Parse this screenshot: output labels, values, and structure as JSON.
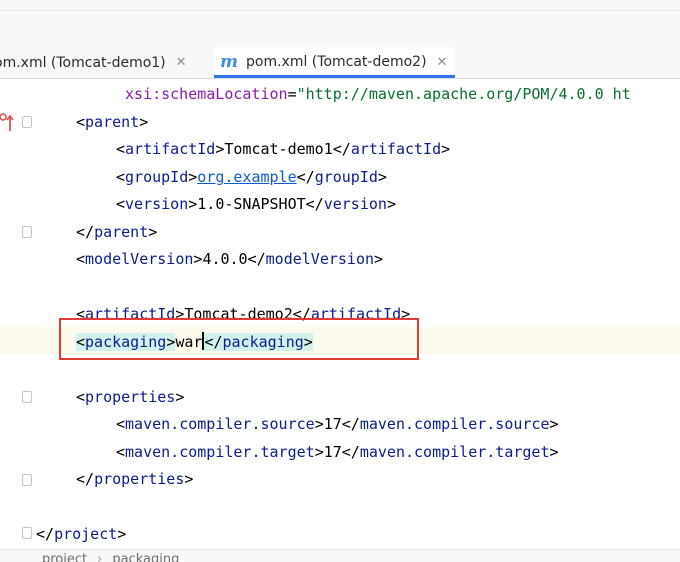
{
  "tabs": [
    {
      "label": "om.xml (Tomcat-demo1)",
      "close": "✕"
    },
    {
      "label": "pom.xml (Tomcat-demo2)",
      "icon": "m",
      "close": "✕"
    }
  ],
  "editor": {
    "lines": [
      {
        "indent": 1,
        "attr": "xsi:schemaLocation",
        "eq": "=",
        "value": "\"http://maven.apache.org/POM/4.0.0 ht"
      },
      {
        "indent": 1,
        "open": "parent"
      },
      {
        "indent": 2,
        "open": "artifactId",
        "text": "Tomcat-demo1",
        "close": "artifactId"
      },
      {
        "indent": 2,
        "open": "groupId",
        "text": "org.example",
        "close": "groupId"
      },
      {
        "indent": 2,
        "open": "version",
        "text": "1.0-SNAPSHOT",
        "close": "version"
      },
      {
        "indent": 1,
        "close": "parent"
      },
      {
        "indent": 1,
        "open": "modelVersion",
        "text": "4.0.0",
        "close": "modelVersion"
      },
      {
        "indent": 1,
        "open": "artifactId",
        "text": "Tomcat-demo2",
        "close": "artifactId"
      },
      {
        "indent": 1,
        "open": "packaging",
        "text_before_cursor": "war",
        "close": "packaging"
      },
      {
        "indent": 1,
        "open": "properties"
      },
      {
        "indent": 2,
        "open": "maven.compiler.source",
        "text": "17",
        "close": "maven.compiler.source"
      },
      {
        "indent": 2,
        "open": "maven.compiler.target",
        "text": "17",
        "close": "maven.compiler.target"
      },
      {
        "indent": 1,
        "close": "properties"
      },
      {
        "indent": 0,
        "close": "project"
      }
    ]
  },
  "breadcrumb": [
    "project",
    "packaging"
  ],
  "colors": {
    "tag": "#0b1c8f",
    "attr": "#8b1bb6",
    "value": "#0a6e2e",
    "highlight_box": "#e53935",
    "tab_accent": "#3574f0"
  }
}
